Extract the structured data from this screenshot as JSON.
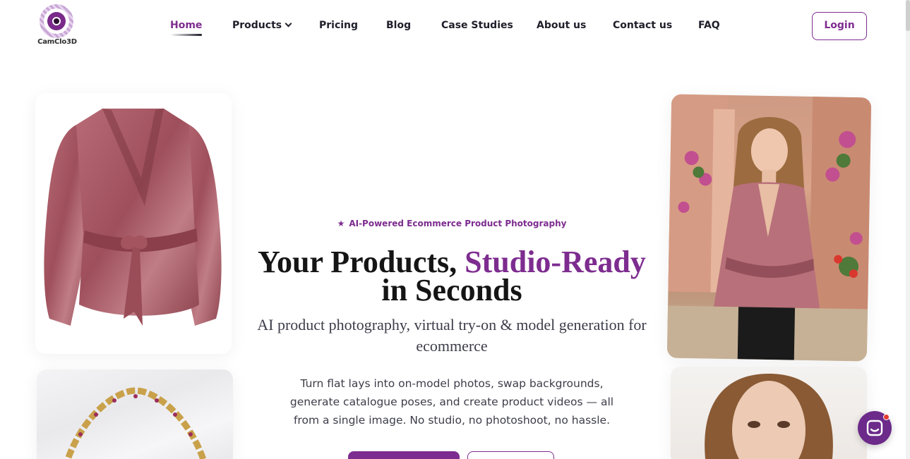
{
  "brand": {
    "name": "CamClo3D",
    "accent_color": "#7d2c8f"
  },
  "nav": {
    "items": [
      {
        "label": "Home",
        "active": true
      },
      {
        "label": "Products",
        "has_dropdown": true
      },
      {
        "label": "Pricing"
      },
      {
        "label": "Blog"
      },
      {
        "label": "Case Studies"
      },
      {
        "label": "About us"
      },
      {
        "label": "Contact us"
      },
      {
        "label": "FAQ"
      }
    ],
    "login_label": "Login"
  },
  "hero": {
    "badge": "AI-Powered Ecommerce Product Photography",
    "badge_icon": "star-icon",
    "headline_part1": "Your Products,",
    "headline_accent": "Studio-Ready",
    "headline_part2": "in Seconds",
    "subheadline": "AI product photography, virtual try-on & model generation for ecommerce",
    "description": "Turn flat lays into on-model photos, swap backgrounds, generate catalogue poses, and create product videos — all from a single image. No studio, no photoshoot, no hassle."
  },
  "gallery": {
    "images": [
      "pink-satin-wrap-blouse",
      "gold-ruby-necklace",
      "model-wearing-blouse",
      "model-portrait"
    ]
  },
  "chat": {
    "icon": "chat-icon",
    "notification": true
  }
}
